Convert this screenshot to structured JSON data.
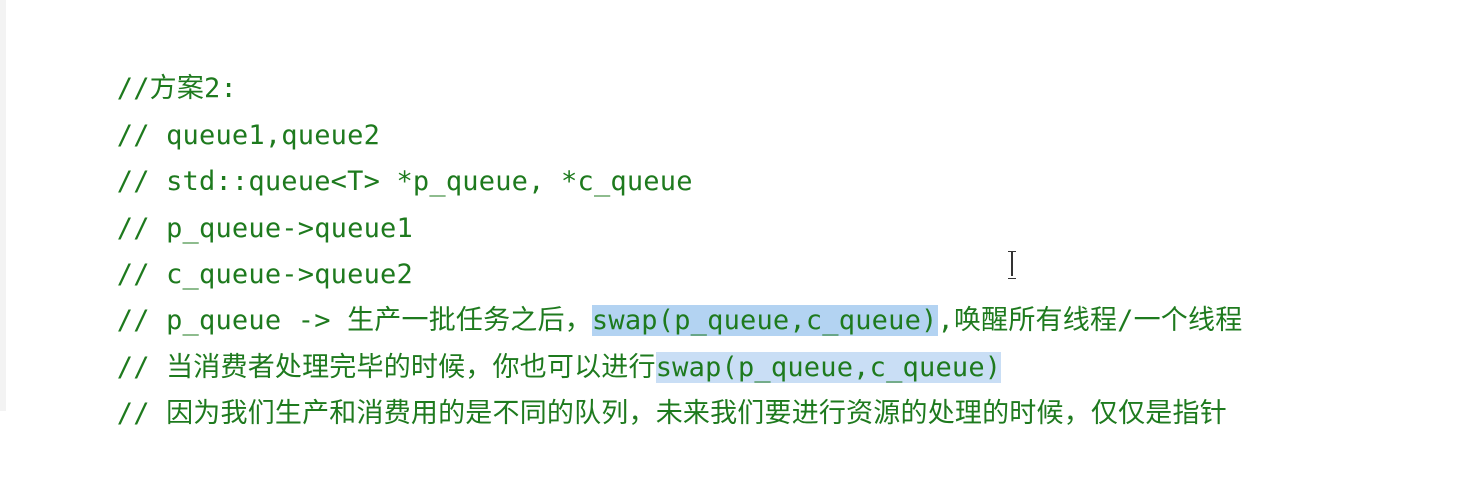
{
  "code_lines": [
    {
      "text": "//方案2:"
    },
    {
      "text": "// queue1,queue2"
    },
    {
      "text": "// std::queue<T> *p_queue, *c_queue"
    },
    {
      "text": "// p_queue->queue1"
    },
    {
      "text": "// c_queue->queue2"
    },
    {
      "prefix": "// p_queue -> 生产一批任务之后，",
      "highlight": "swap(p_queue,c_queue)",
      "suffix": ",唤醒所有线程/一个线程"
    },
    {
      "prefix": "// 当消费者处理完毕的时候，你也可以进行",
      "highlight": "swap(p_queue,c_queue)",
      "suffix": ""
    },
    {
      "text": "// 因为我们生产和消费用的是不同的队列，未来我们要进行资源的处理的时候，仅仅是指针"
    }
  ],
  "colors": {
    "comment": "#1e7a1e",
    "background": "#ffffff",
    "selection": "#b3d3f2",
    "word_highlight": "#c9def5"
  },
  "cursor": "i-beam-cursor"
}
